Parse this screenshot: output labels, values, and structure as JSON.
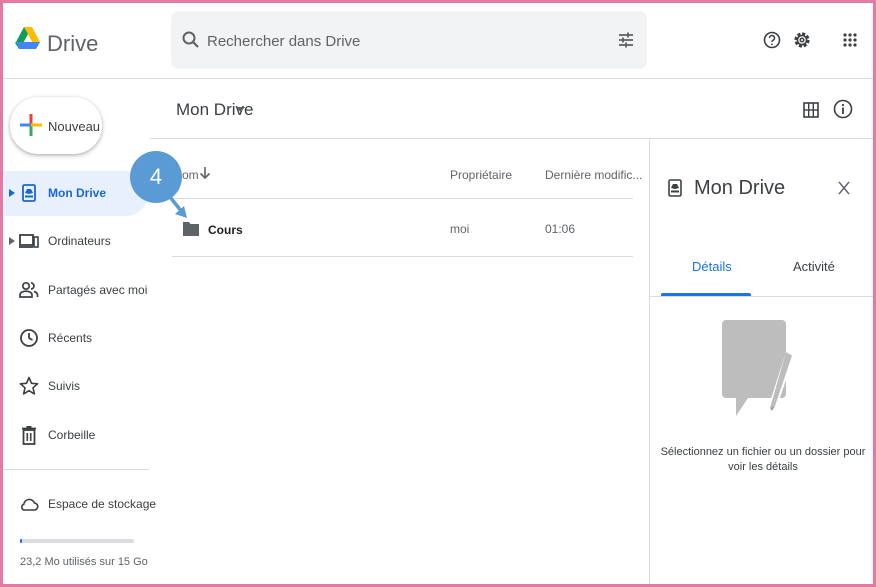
{
  "header": {
    "app_name": "Drive",
    "search": {
      "placeholder": "Rechercher dans Drive"
    }
  },
  "sidebar": {
    "new_button": "Nouveau",
    "items": [
      {
        "label": "Mon Drive",
        "icon": "drive-icon",
        "active": true
      },
      {
        "label": "Ordinateurs",
        "icon": "computer-icon"
      },
      {
        "label": "Partagés avec moi",
        "icon": "people-icon"
      },
      {
        "label": "Récents",
        "icon": "clock-icon"
      },
      {
        "label": "Suivis",
        "icon": "star-icon"
      },
      {
        "label": "Corbeille",
        "icon": "trash-icon"
      },
      {
        "label": "Espace de stockage",
        "icon": "cloud-icon"
      }
    ],
    "storage_text": "23,2 Mo utilisés sur 15 Go"
  },
  "main": {
    "breadcrumb": "Mon Drive",
    "columns": {
      "name": "om",
      "owner": "Propriétaire",
      "modified": "Dernière modific..."
    },
    "rows": [
      {
        "name": "Cours",
        "owner": "moi",
        "modified": "01:06"
      }
    ],
    "step_marker": "4"
  },
  "details_panel": {
    "title": "Mon Drive",
    "tabs": [
      "Détails",
      "Activité"
    ],
    "empty_text": "Sélectionnez un fichier ou un dossier pour voir les détails"
  },
  "colors": {
    "accent": "#1a73e8",
    "active_bg": "#e8f0fe",
    "marker": "#5b9bd5",
    "frame": "#e47aa4"
  }
}
